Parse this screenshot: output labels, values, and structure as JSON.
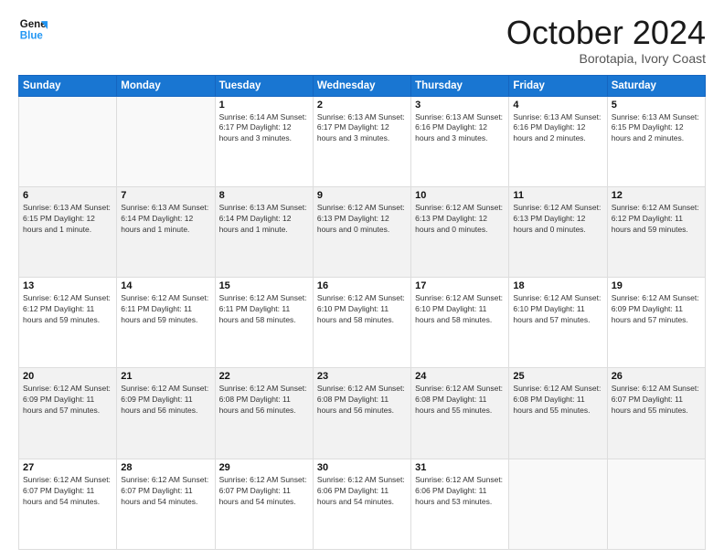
{
  "logo": {
    "line1": "General",
    "line2": "Blue"
  },
  "header": {
    "month": "October 2024",
    "location": "Borotapia, Ivory Coast"
  },
  "weekdays": [
    "Sunday",
    "Monday",
    "Tuesday",
    "Wednesday",
    "Thursday",
    "Friday",
    "Saturday"
  ],
  "weeks": [
    [
      {
        "day": "",
        "info": ""
      },
      {
        "day": "",
        "info": ""
      },
      {
        "day": "1",
        "info": "Sunrise: 6:14 AM\nSunset: 6:17 PM\nDaylight: 12 hours and 3 minutes."
      },
      {
        "day": "2",
        "info": "Sunrise: 6:13 AM\nSunset: 6:17 PM\nDaylight: 12 hours and 3 minutes."
      },
      {
        "day": "3",
        "info": "Sunrise: 6:13 AM\nSunset: 6:16 PM\nDaylight: 12 hours and 3 minutes."
      },
      {
        "day": "4",
        "info": "Sunrise: 6:13 AM\nSunset: 6:16 PM\nDaylight: 12 hours and 2 minutes."
      },
      {
        "day": "5",
        "info": "Sunrise: 6:13 AM\nSunset: 6:15 PM\nDaylight: 12 hours and 2 minutes."
      }
    ],
    [
      {
        "day": "6",
        "info": "Sunrise: 6:13 AM\nSunset: 6:15 PM\nDaylight: 12 hours and 1 minute."
      },
      {
        "day": "7",
        "info": "Sunrise: 6:13 AM\nSunset: 6:14 PM\nDaylight: 12 hours and 1 minute."
      },
      {
        "day": "8",
        "info": "Sunrise: 6:13 AM\nSunset: 6:14 PM\nDaylight: 12 hours and 1 minute."
      },
      {
        "day": "9",
        "info": "Sunrise: 6:12 AM\nSunset: 6:13 PM\nDaylight: 12 hours and 0 minutes."
      },
      {
        "day": "10",
        "info": "Sunrise: 6:12 AM\nSunset: 6:13 PM\nDaylight: 12 hours and 0 minutes."
      },
      {
        "day": "11",
        "info": "Sunrise: 6:12 AM\nSunset: 6:13 PM\nDaylight: 12 hours and 0 minutes."
      },
      {
        "day": "12",
        "info": "Sunrise: 6:12 AM\nSunset: 6:12 PM\nDaylight: 11 hours and 59 minutes."
      }
    ],
    [
      {
        "day": "13",
        "info": "Sunrise: 6:12 AM\nSunset: 6:12 PM\nDaylight: 11 hours and 59 minutes."
      },
      {
        "day": "14",
        "info": "Sunrise: 6:12 AM\nSunset: 6:11 PM\nDaylight: 11 hours and 59 minutes."
      },
      {
        "day": "15",
        "info": "Sunrise: 6:12 AM\nSunset: 6:11 PM\nDaylight: 11 hours and 58 minutes."
      },
      {
        "day": "16",
        "info": "Sunrise: 6:12 AM\nSunset: 6:10 PM\nDaylight: 11 hours and 58 minutes."
      },
      {
        "day": "17",
        "info": "Sunrise: 6:12 AM\nSunset: 6:10 PM\nDaylight: 11 hours and 58 minutes."
      },
      {
        "day": "18",
        "info": "Sunrise: 6:12 AM\nSunset: 6:10 PM\nDaylight: 11 hours and 57 minutes."
      },
      {
        "day": "19",
        "info": "Sunrise: 6:12 AM\nSunset: 6:09 PM\nDaylight: 11 hours and 57 minutes."
      }
    ],
    [
      {
        "day": "20",
        "info": "Sunrise: 6:12 AM\nSunset: 6:09 PM\nDaylight: 11 hours and 57 minutes."
      },
      {
        "day": "21",
        "info": "Sunrise: 6:12 AM\nSunset: 6:09 PM\nDaylight: 11 hours and 56 minutes."
      },
      {
        "day": "22",
        "info": "Sunrise: 6:12 AM\nSunset: 6:08 PM\nDaylight: 11 hours and 56 minutes."
      },
      {
        "day": "23",
        "info": "Sunrise: 6:12 AM\nSunset: 6:08 PM\nDaylight: 11 hours and 56 minutes."
      },
      {
        "day": "24",
        "info": "Sunrise: 6:12 AM\nSunset: 6:08 PM\nDaylight: 11 hours and 55 minutes."
      },
      {
        "day": "25",
        "info": "Sunrise: 6:12 AM\nSunset: 6:08 PM\nDaylight: 11 hours and 55 minutes."
      },
      {
        "day": "26",
        "info": "Sunrise: 6:12 AM\nSunset: 6:07 PM\nDaylight: 11 hours and 55 minutes."
      }
    ],
    [
      {
        "day": "27",
        "info": "Sunrise: 6:12 AM\nSunset: 6:07 PM\nDaylight: 11 hours and 54 minutes."
      },
      {
        "day": "28",
        "info": "Sunrise: 6:12 AM\nSunset: 6:07 PM\nDaylight: 11 hours and 54 minutes."
      },
      {
        "day": "29",
        "info": "Sunrise: 6:12 AM\nSunset: 6:07 PM\nDaylight: 11 hours and 54 minutes."
      },
      {
        "day": "30",
        "info": "Sunrise: 6:12 AM\nSunset: 6:06 PM\nDaylight: 11 hours and 54 minutes."
      },
      {
        "day": "31",
        "info": "Sunrise: 6:12 AM\nSunset: 6:06 PM\nDaylight: 11 hours and 53 minutes."
      },
      {
        "day": "",
        "info": ""
      },
      {
        "day": "",
        "info": ""
      }
    ]
  ]
}
